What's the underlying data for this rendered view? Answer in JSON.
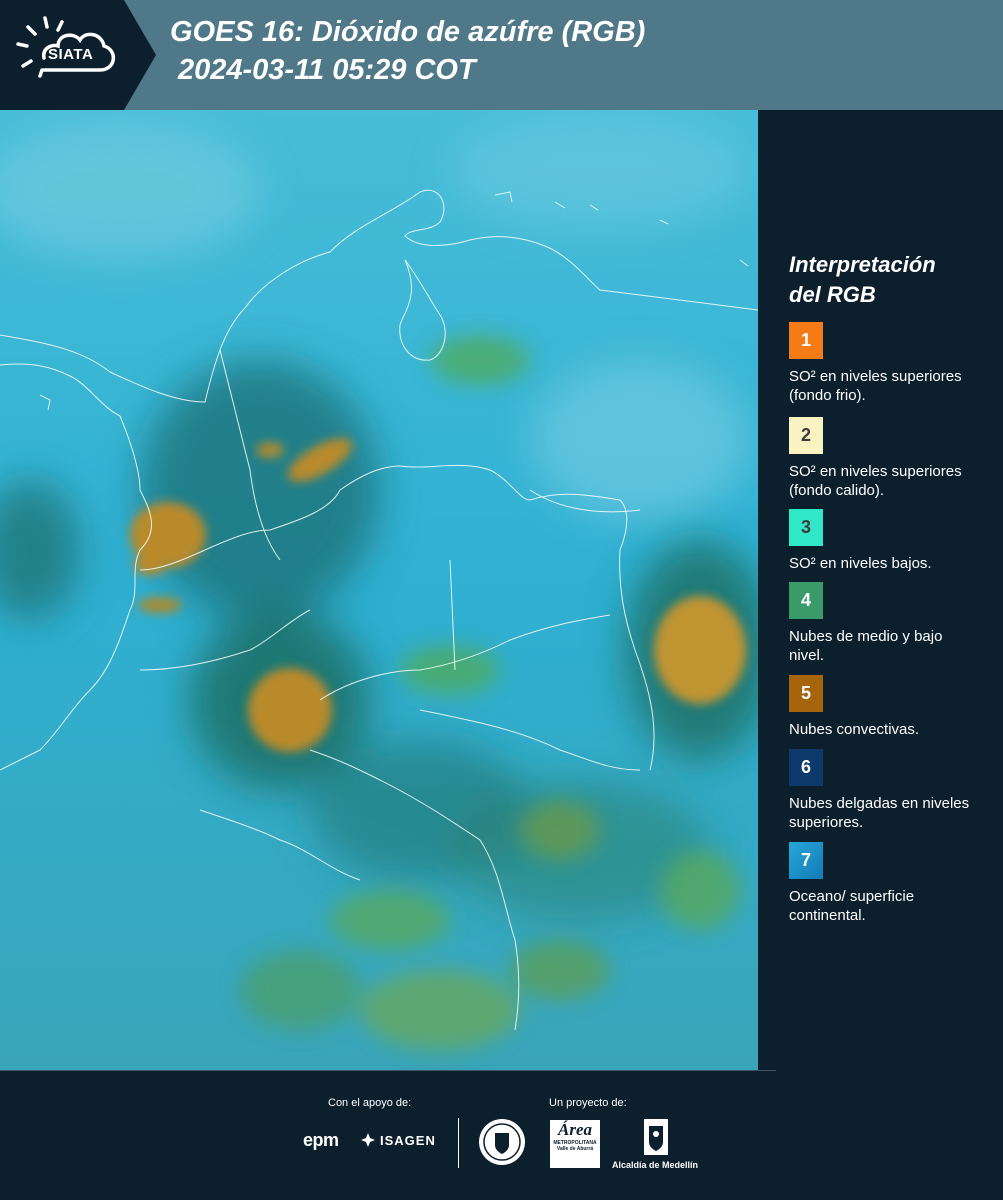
{
  "header": {
    "logo_text": "SIATA",
    "title_line1": "GOES 16: Dióxido de azúfre (RGB)",
    "title_line2": "2024-03-11 05:29 COT"
  },
  "legend": {
    "title_line1": "Interpretación",
    "title_line2": "del RGB",
    "items": [
      {
        "number": "1",
        "color": "#f47b16",
        "label": "SO² en niveles superiores (fondo frio)."
      },
      {
        "number": "2",
        "color": "#fbf2c2",
        "label": "SO² en niveles superiores (fondo calido)."
      },
      {
        "number": "3",
        "color": "#2ee8c7",
        "label": "SO² en niveles bajos."
      },
      {
        "number": "4",
        "color": "#3a9a6a",
        "label": "Nubes de medio y bajo nivel."
      },
      {
        "number": "5",
        "color": "#a6650d",
        "label": "Nubes convectivas."
      },
      {
        "number": "6",
        "color": "#0e3a6b",
        "label": "Nubes delgadas en niveles superiores."
      },
      {
        "number": "7",
        "color": "#1c8fc4",
        "label": "Oceano/ superficie continental."
      }
    ]
  },
  "footer": {
    "support_label": "Con el apoyo de:",
    "project_label": "Un proyecto de:",
    "epm": "epm",
    "isagen": "ISAGEN",
    "area_mark": "Área",
    "area_sub": "METROPOLITANA Valle de Aburrá",
    "alcaldia": "Alcaldía de Medellín"
  },
  "colors": {
    "background": "#0c1f2d",
    "header_band": "#4f7888",
    "ocean_surface": "#2fb0d2",
    "convective": "#b98a2a",
    "vegetation_green": "#4faa5a"
  }
}
